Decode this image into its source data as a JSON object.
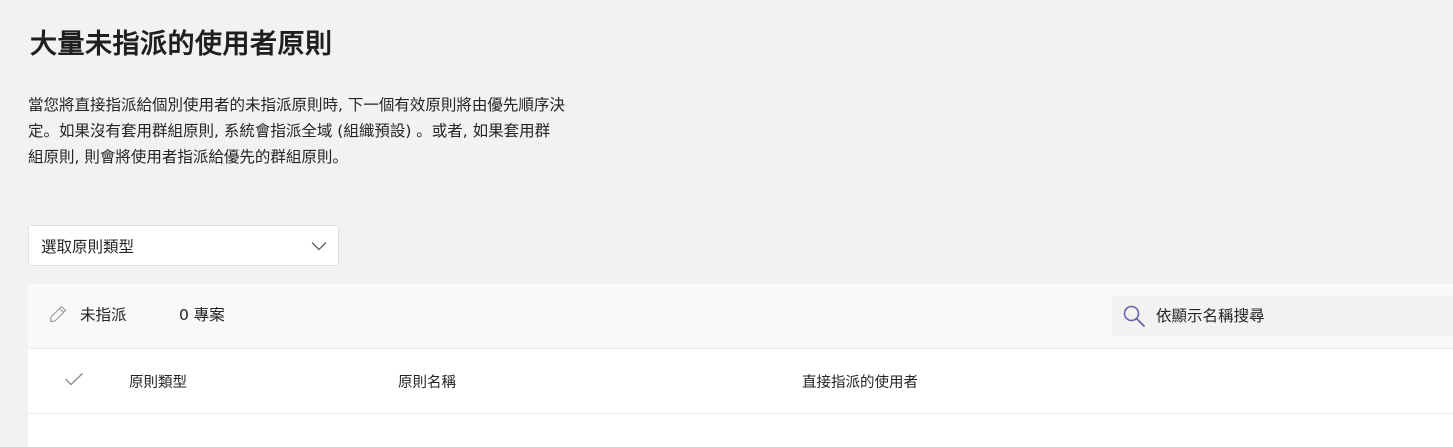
{
  "page": {
    "title": "大量未指派的使用者原則",
    "description_lines": [
      "當您將直接指派給個別使用者的未指派原則時, 下一個有效原則將由優先順序決",
      "定。如果沒有套用群組原則, 系統會指派全域 (組織預設) 。或者, 如果套用群",
      "組原則, 則會將使用者指派給優先的群組原則。"
    ]
  },
  "filter": {
    "policy_type_placeholder": "選取原則類型",
    "icon": "chevron-down-icon"
  },
  "toolbar": {
    "unassign_label": "未指派",
    "unassign_icon": "pencil-icon",
    "items_count": "0 專案",
    "search_placeholder": "依顯示名稱搜尋",
    "search_icon": "search-icon"
  },
  "table": {
    "select_all_icon": "checkmark-icon",
    "columns": [
      "原則類型",
      "原則名稱",
      "直接指派的使用者"
    ],
    "rows": []
  },
  "colors": {
    "background": "#f3f2f1",
    "surface": "#ffffff",
    "toolbar": "#faf9f8",
    "accent_icon": "#6264a7"
  }
}
